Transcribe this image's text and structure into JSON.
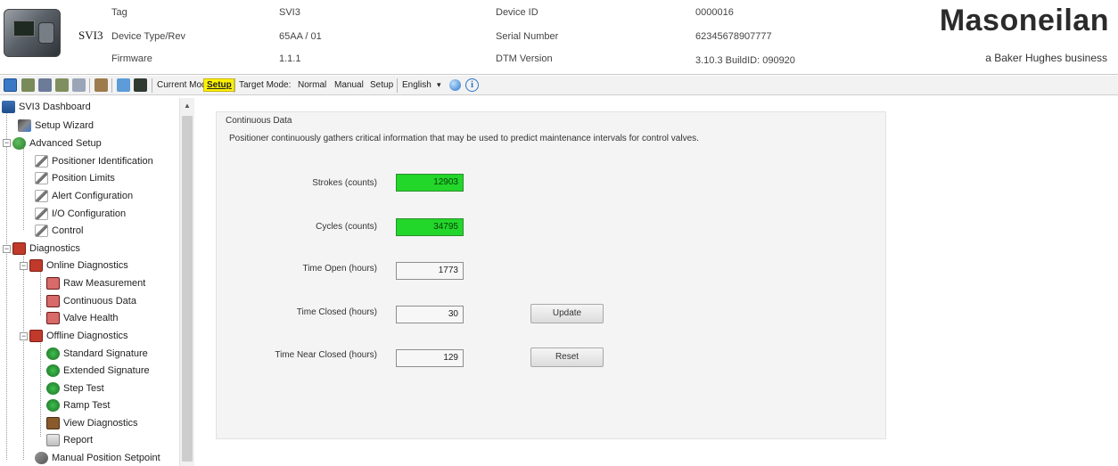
{
  "header": {
    "device_name": "SVI3",
    "labels": {
      "tag": "Tag",
      "device_type_rev": "Device Type/Rev",
      "firmware": "Firmware",
      "device_id": "Device ID",
      "serial_number": "Serial Number",
      "dtm_version": "DTM Version"
    },
    "values": {
      "tag": "SVI3",
      "device_type_rev": "65AA / 01",
      "firmware": "1.1.1",
      "device_id": "0000016",
      "serial_number": "62345678907777",
      "dtm_version": "3.10.3 BuildID: 090920"
    },
    "brand": "Masoneilan",
    "brand_sub": "a Baker Hughes business"
  },
  "toolbar": {
    "current_mode_label": "Current Mode:",
    "current_mode_value": "Setup",
    "target_mode_label": "Target Mode:",
    "modes": [
      "Normal",
      "Manual",
      "Setup"
    ],
    "language": "English",
    "dropdown_arrow": "▾",
    "info_glyph": "i"
  },
  "tree": {
    "items": [
      {
        "label": "SVI3 Dashboard",
        "icon": "dashboard-icon"
      },
      {
        "label": "Setup Wizard",
        "icon": "wizard-icon"
      },
      {
        "label": "Advanced Setup",
        "icon": "advanced-setup-icon"
      },
      {
        "label": "Positioner Identification",
        "icon": "pencil-icon"
      },
      {
        "label": "Position Limits",
        "icon": "pencil-icon"
      },
      {
        "label": "Alert Configuration",
        "icon": "pencil-icon"
      },
      {
        "label": "I/O Configuration",
        "icon": "pencil-icon"
      },
      {
        "label": "Control",
        "icon": "pencil-icon"
      },
      {
        "label": "Diagnostics",
        "icon": "folder-icon"
      },
      {
        "label": "Online Diagnostics",
        "icon": "folder-icon"
      },
      {
        "label": "Raw Measurement",
        "icon": "monitor-icon"
      },
      {
        "label": "Continuous Data",
        "icon": "monitor-icon"
      },
      {
        "label": "Valve Health",
        "icon": "monitor-icon"
      },
      {
        "label": "Offline Diagnostics",
        "icon": "folder-icon"
      },
      {
        "label": "Standard Signature",
        "icon": "green-circle-icon"
      },
      {
        "label": "Extended Signature",
        "icon": "green-circle-icon"
      },
      {
        "label": "Step Test",
        "icon": "green-circle-icon"
      },
      {
        "label": "Ramp Test",
        "icon": "green-circle-icon"
      },
      {
        "label": "View Diagnostics",
        "icon": "view-diagnostics-icon"
      },
      {
        "label": "Report",
        "icon": "report-icon"
      },
      {
        "label": "Manual Position Setpoint",
        "icon": "manual-position-icon"
      }
    ],
    "expander_minus": "−",
    "scroll_up_glyph": "▲"
  },
  "main": {
    "group_title": "Continuous Data",
    "description": "Positioner continuously gathers critical information that may be used to predict maintenance intervals for control valves.",
    "fields": [
      {
        "label": "Strokes (counts)",
        "value": "12903",
        "highlight": "#22d62a"
      },
      {
        "label": "Cycles (counts)",
        "value": "34795",
        "highlight": "#22d62a"
      },
      {
        "label": "Time Open (hours)",
        "value": "1773"
      },
      {
        "label": "Time Closed (hours)",
        "value": "30"
      },
      {
        "label": "Time Near Closed (hours)",
        "value": "129"
      }
    ],
    "update_label": "Update",
    "reset_label": "Reset"
  },
  "colors": {
    "setup_highlight": "#fff200",
    "counter_green": "#22d62a",
    "info_blue": "#2a74c9"
  }
}
